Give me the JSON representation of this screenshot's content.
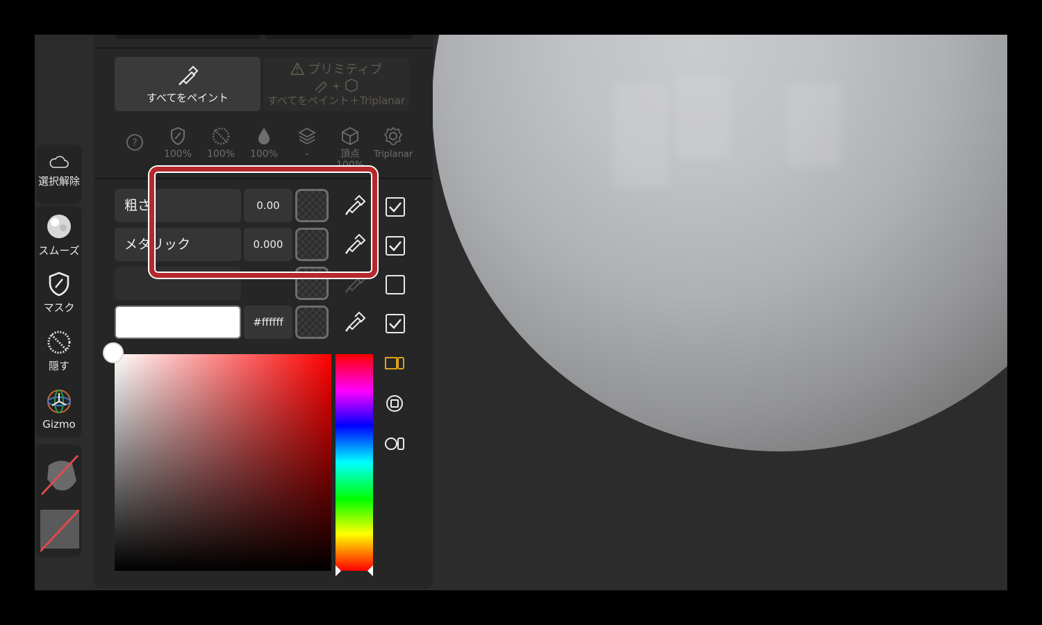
{
  "app": {
    "title": ""
  },
  "left_toolbar": {
    "items": [
      {
        "label": "選択解除",
        "icon": "cloud-outline-icon"
      },
      {
        "label": "スムーズ",
        "icon": "smooth-ball-icon"
      },
      {
        "label": "マスク",
        "icon": "mask-shield-icon"
      },
      {
        "label": "隠す",
        "icon": "hide-dotted-icon"
      },
      {
        "label": "Gizmo",
        "icon": "gizmo-axes-icon"
      }
    ],
    "bottom": [
      {
        "icon": "matcap-disabled-icon"
      },
      {
        "icon": "texture-disabled-icon"
      }
    ]
  },
  "paint_panel": {
    "modes": [
      {
        "label": "すべてをペイント",
        "icon": "brush-icon",
        "active": true
      },
      {
        "label": "プリミティブ",
        "sub": "すべてをペイント＋Triplanar",
        "icon": "warning-icon",
        "active": false
      }
    ],
    "stats": [
      {
        "icon": "help-icon",
        "value": ""
      },
      {
        "icon": "mask-shield-icon",
        "value": "100%"
      },
      {
        "icon": "hide-dotted-icon",
        "value": "100%"
      },
      {
        "icon": "drop-icon",
        "value": "100%"
      },
      {
        "icon": "layers-icon",
        "value": "-"
      },
      {
        "icon": "cube-icon",
        "value": "頂点\n100%",
        "label": "頂点",
        "pct": "100%"
      },
      {
        "icon": "gear-icon",
        "value": "Triplanar"
      }
    ],
    "rows": [
      {
        "label": "粗さ",
        "value": "0.00",
        "checked": true
      },
      {
        "label": "メタリック",
        "value": "0.000",
        "checked": true
      },
      {
        "label": "",
        "value": "",
        "checked": false
      },
      {
        "label": "",
        "value": "#ffffff",
        "checked": true
      }
    ],
    "color": {
      "hex": "#ffffff",
      "hue_position": 1.0
    },
    "color_modes": [
      "split-view-icon",
      "circle-target-icon",
      "circle-rect-icon"
    ],
    "accent": "#e0a21a",
    "highlight_color": "#b5282d"
  }
}
